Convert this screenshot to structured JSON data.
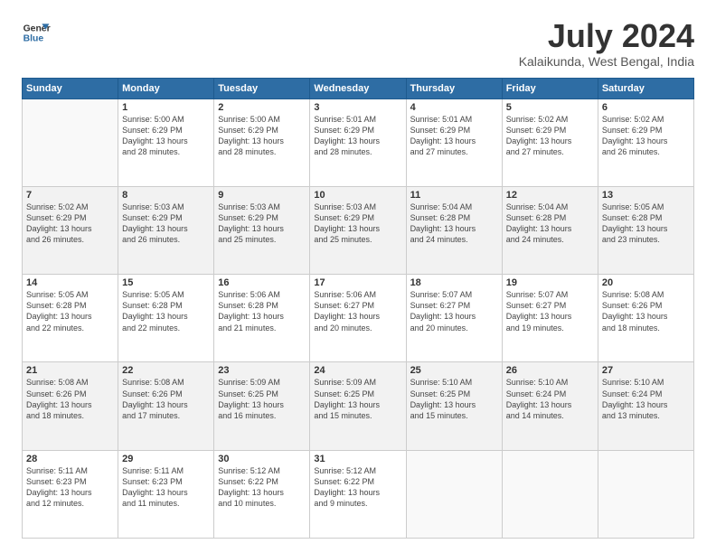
{
  "header": {
    "logo_line1": "General",
    "logo_line2": "Blue",
    "month_year": "July 2024",
    "location": "Kalaikunda, West Bengal, India"
  },
  "days_of_week": [
    "Sunday",
    "Monday",
    "Tuesday",
    "Wednesday",
    "Thursday",
    "Friday",
    "Saturday"
  ],
  "weeks": [
    [
      {
        "day": "",
        "info": ""
      },
      {
        "day": "1",
        "info": "Sunrise: 5:00 AM\nSunset: 6:29 PM\nDaylight: 13 hours\nand 28 minutes."
      },
      {
        "day": "2",
        "info": "Sunrise: 5:00 AM\nSunset: 6:29 PM\nDaylight: 13 hours\nand 28 minutes."
      },
      {
        "day": "3",
        "info": "Sunrise: 5:01 AM\nSunset: 6:29 PM\nDaylight: 13 hours\nand 28 minutes."
      },
      {
        "day": "4",
        "info": "Sunrise: 5:01 AM\nSunset: 6:29 PM\nDaylight: 13 hours\nand 27 minutes."
      },
      {
        "day": "5",
        "info": "Sunrise: 5:02 AM\nSunset: 6:29 PM\nDaylight: 13 hours\nand 27 minutes."
      },
      {
        "day": "6",
        "info": "Sunrise: 5:02 AM\nSunset: 6:29 PM\nDaylight: 13 hours\nand 26 minutes."
      }
    ],
    [
      {
        "day": "7",
        "info": "Sunrise: 5:02 AM\nSunset: 6:29 PM\nDaylight: 13 hours\nand 26 minutes."
      },
      {
        "day": "8",
        "info": "Sunrise: 5:03 AM\nSunset: 6:29 PM\nDaylight: 13 hours\nand 26 minutes."
      },
      {
        "day": "9",
        "info": "Sunrise: 5:03 AM\nSunset: 6:29 PM\nDaylight: 13 hours\nand 25 minutes."
      },
      {
        "day": "10",
        "info": "Sunrise: 5:03 AM\nSunset: 6:29 PM\nDaylight: 13 hours\nand 25 minutes."
      },
      {
        "day": "11",
        "info": "Sunrise: 5:04 AM\nSunset: 6:28 PM\nDaylight: 13 hours\nand 24 minutes."
      },
      {
        "day": "12",
        "info": "Sunrise: 5:04 AM\nSunset: 6:28 PM\nDaylight: 13 hours\nand 24 minutes."
      },
      {
        "day": "13",
        "info": "Sunrise: 5:05 AM\nSunset: 6:28 PM\nDaylight: 13 hours\nand 23 minutes."
      }
    ],
    [
      {
        "day": "14",
        "info": "Sunrise: 5:05 AM\nSunset: 6:28 PM\nDaylight: 13 hours\nand 22 minutes."
      },
      {
        "day": "15",
        "info": "Sunrise: 5:05 AM\nSunset: 6:28 PM\nDaylight: 13 hours\nand 22 minutes."
      },
      {
        "day": "16",
        "info": "Sunrise: 5:06 AM\nSunset: 6:28 PM\nDaylight: 13 hours\nand 21 minutes."
      },
      {
        "day": "17",
        "info": "Sunrise: 5:06 AM\nSunset: 6:27 PM\nDaylight: 13 hours\nand 20 minutes."
      },
      {
        "day": "18",
        "info": "Sunrise: 5:07 AM\nSunset: 6:27 PM\nDaylight: 13 hours\nand 20 minutes."
      },
      {
        "day": "19",
        "info": "Sunrise: 5:07 AM\nSunset: 6:27 PM\nDaylight: 13 hours\nand 19 minutes."
      },
      {
        "day": "20",
        "info": "Sunrise: 5:08 AM\nSunset: 6:26 PM\nDaylight: 13 hours\nand 18 minutes."
      }
    ],
    [
      {
        "day": "21",
        "info": "Sunrise: 5:08 AM\nSunset: 6:26 PM\nDaylight: 13 hours\nand 18 minutes."
      },
      {
        "day": "22",
        "info": "Sunrise: 5:08 AM\nSunset: 6:26 PM\nDaylight: 13 hours\nand 17 minutes."
      },
      {
        "day": "23",
        "info": "Sunrise: 5:09 AM\nSunset: 6:25 PM\nDaylight: 13 hours\nand 16 minutes."
      },
      {
        "day": "24",
        "info": "Sunrise: 5:09 AM\nSunset: 6:25 PM\nDaylight: 13 hours\nand 15 minutes."
      },
      {
        "day": "25",
        "info": "Sunrise: 5:10 AM\nSunset: 6:25 PM\nDaylight: 13 hours\nand 15 minutes."
      },
      {
        "day": "26",
        "info": "Sunrise: 5:10 AM\nSunset: 6:24 PM\nDaylight: 13 hours\nand 14 minutes."
      },
      {
        "day": "27",
        "info": "Sunrise: 5:10 AM\nSunset: 6:24 PM\nDaylight: 13 hours\nand 13 minutes."
      }
    ],
    [
      {
        "day": "28",
        "info": "Sunrise: 5:11 AM\nSunset: 6:23 PM\nDaylight: 13 hours\nand 12 minutes."
      },
      {
        "day": "29",
        "info": "Sunrise: 5:11 AM\nSunset: 6:23 PM\nDaylight: 13 hours\nand 11 minutes."
      },
      {
        "day": "30",
        "info": "Sunrise: 5:12 AM\nSunset: 6:22 PM\nDaylight: 13 hours\nand 10 minutes."
      },
      {
        "day": "31",
        "info": "Sunrise: 5:12 AM\nSunset: 6:22 PM\nDaylight: 13 hours\nand 9 minutes."
      },
      {
        "day": "",
        "info": ""
      },
      {
        "day": "",
        "info": ""
      },
      {
        "day": "",
        "info": ""
      }
    ]
  ]
}
